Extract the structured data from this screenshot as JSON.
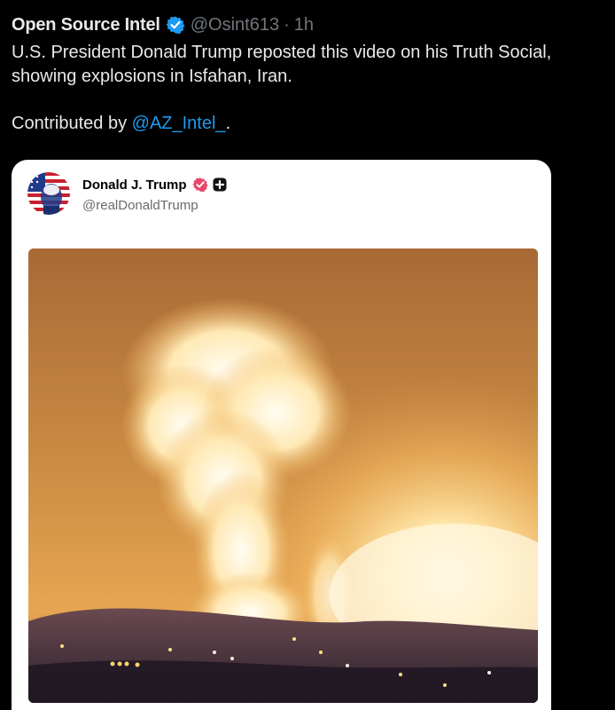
{
  "tweet": {
    "author_name": "Open Source Intel",
    "handle": "@Osint613",
    "separator": "·",
    "time": "1h",
    "text_line1": "U.S. President Donald Trump reposted this video on his Truth Social,",
    "text_line2": "showing explosions in Isfahan, Iran.",
    "contrib_prefix": "Contributed by ",
    "contrib_mention": "@AZ_Intel_",
    "contrib_suffix": "."
  },
  "embedded_post": {
    "name": "Donald J. Trump",
    "handle": "@realDonaldTrump"
  },
  "icons": {
    "verified": "verified-badge-icon",
    "embedded_verified": "pink-verified-badge-icon",
    "embedded_plus": "plus-badge-icon"
  },
  "colors": {
    "background": "#000000",
    "text": "#e7e9ea",
    "muted": "#71767b",
    "link": "#1d9bf0",
    "verified_blue": "#1d9bf0",
    "truth_pink": "#e8496b"
  }
}
